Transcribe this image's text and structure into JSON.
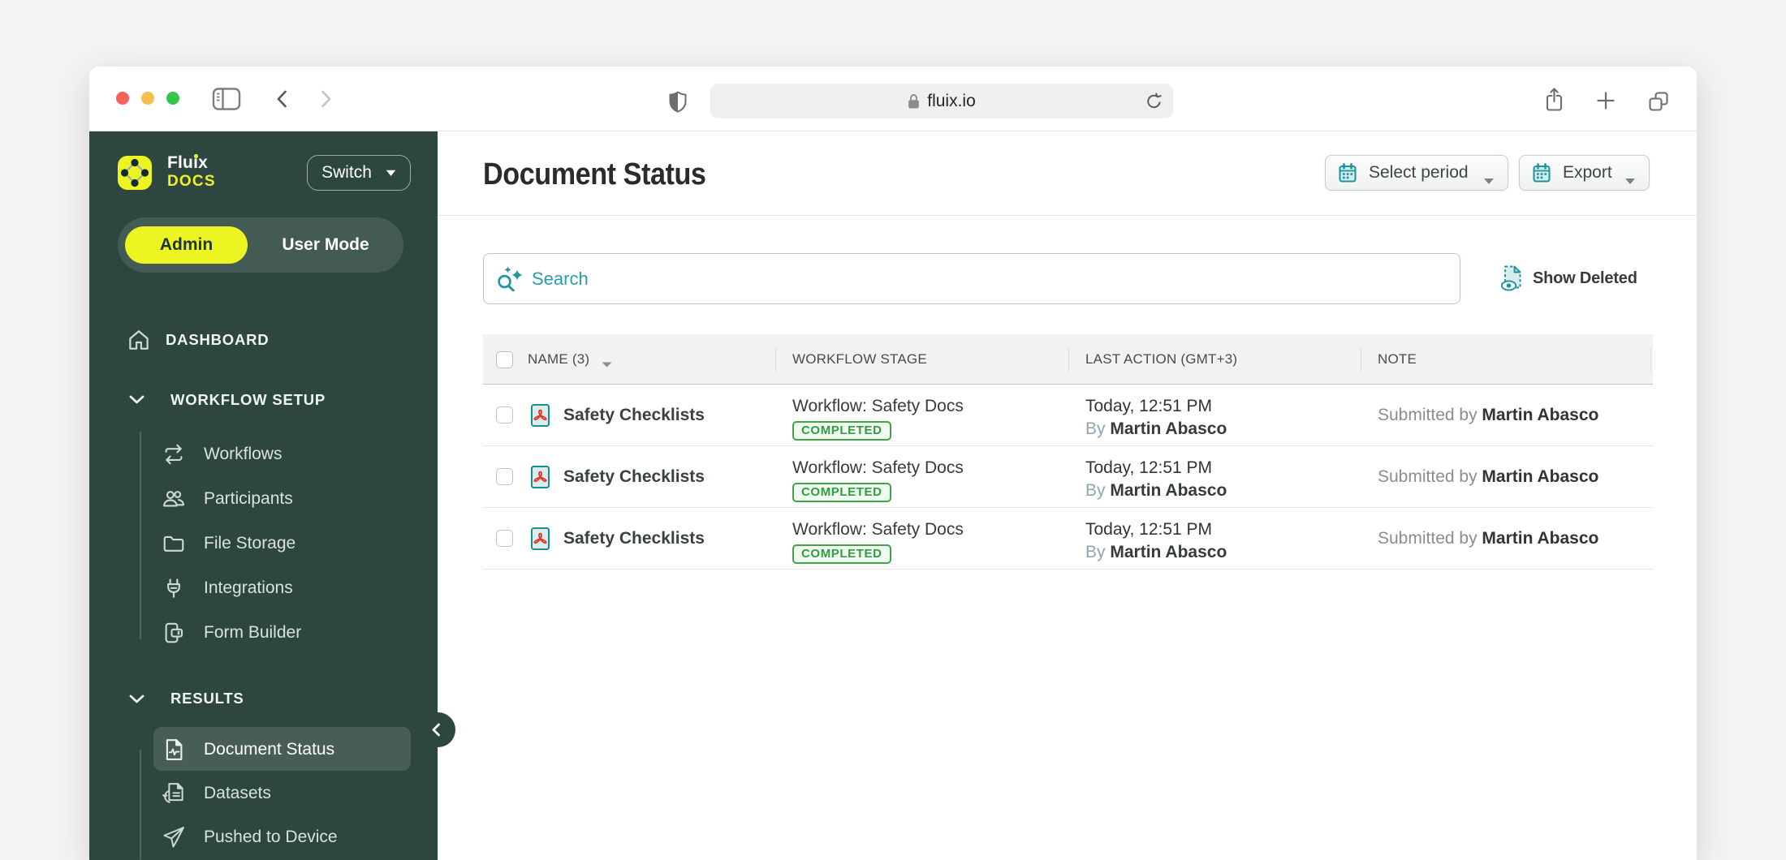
{
  "browser": {
    "url": "fluix.io",
    "traffic_lights": [
      "close",
      "minimize",
      "zoom"
    ],
    "controls": [
      "sidebar-toggle",
      "back",
      "forward",
      "shield",
      "reload",
      "share",
      "new-tab",
      "tab-overview"
    ]
  },
  "sidebar": {
    "brand": {
      "line1": "Fluix",
      "line2": "DOCS"
    },
    "switch_label": "Switch",
    "mode_toggle": {
      "admin": "Admin",
      "user": "User Mode",
      "active": "Admin"
    },
    "dashboard_label": "DASHBOARD",
    "groups": [
      {
        "label": "WORKFLOW SETUP",
        "expanded": true,
        "items": [
          {
            "label": "Workflows"
          },
          {
            "label": "Participants"
          },
          {
            "label": "File Storage"
          },
          {
            "label": "Integrations"
          },
          {
            "label": "Form Builder"
          }
        ]
      },
      {
        "label": "RESULTS",
        "expanded": true,
        "items": [
          {
            "label": "Document Status",
            "selected": true
          },
          {
            "label": "Datasets"
          },
          {
            "label": "Pushed to Device"
          }
        ]
      }
    ]
  },
  "header": {
    "title": "Document Status",
    "select_period_label": "Select period",
    "export_label": "Export"
  },
  "toolbar": {
    "search_placeholder": "Search",
    "show_deleted_label": "Show Deleted"
  },
  "table": {
    "columns": [
      "NAME (3)",
      "WORKFLOW STAGE",
      "LAST ACTION (GMT+3)",
      "NOTE"
    ],
    "sorted_column": "NAME (3)",
    "rows": [
      {
        "name": "Safety Checklists",
        "file_type": "pdf",
        "workflow": "Workflow: Safety Docs",
        "status": "COMPLETED",
        "time": "Today, 12:51 PM",
        "by_label": "By",
        "by_name": "Martin Abasco",
        "note_prefix": "Submitted by",
        "note_name": "Martin Abasco"
      },
      {
        "name": "Safety Checklists",
        "file_type": "pdf",
        "workflow": "Workflow: Safety Docs",
        "status": "COMPLETED",
        "time": "Today, 12:51 PM",
        "by_label": "By",
        "by_name": "Martin Abasco",
        "note_prefix": "Submitted by",
        "note_name": "Martin Abasco"
      },
      {
        "name": "Safety Checklists",
        "file_type": "pdf",
        "workflow": "Workflow: Safety Docs",
        "status": "COMPLETED",
        "time": "Today, 12:51 PM",
        "by_label": "By",
        "by_name": "Martin Abasco",
        "note_prefix": "Submitted by",
        "note_name": "Martin Abasco"
      }
    ]
  },
  "icons": {
    "logo": "yellow-squircle-diamond-nodes",
    "search": "magnifier-with-sparkles",
    "show_deleted": "document-dashed-with-eye",
    "calendar": "teal-calendar-grid",
    "pdf": "adobe-acrobat-page",
    "collapse": "chevron-left-circle"
  },
  "colors": {
    "accent_yellow": "#ecf522",
    "sidebar_green": "#2d4640",
    "teal": "#1f969d",
    "badge_green": "#3ba343",
    "page_bg": "#f4f3f1"
  }
}
